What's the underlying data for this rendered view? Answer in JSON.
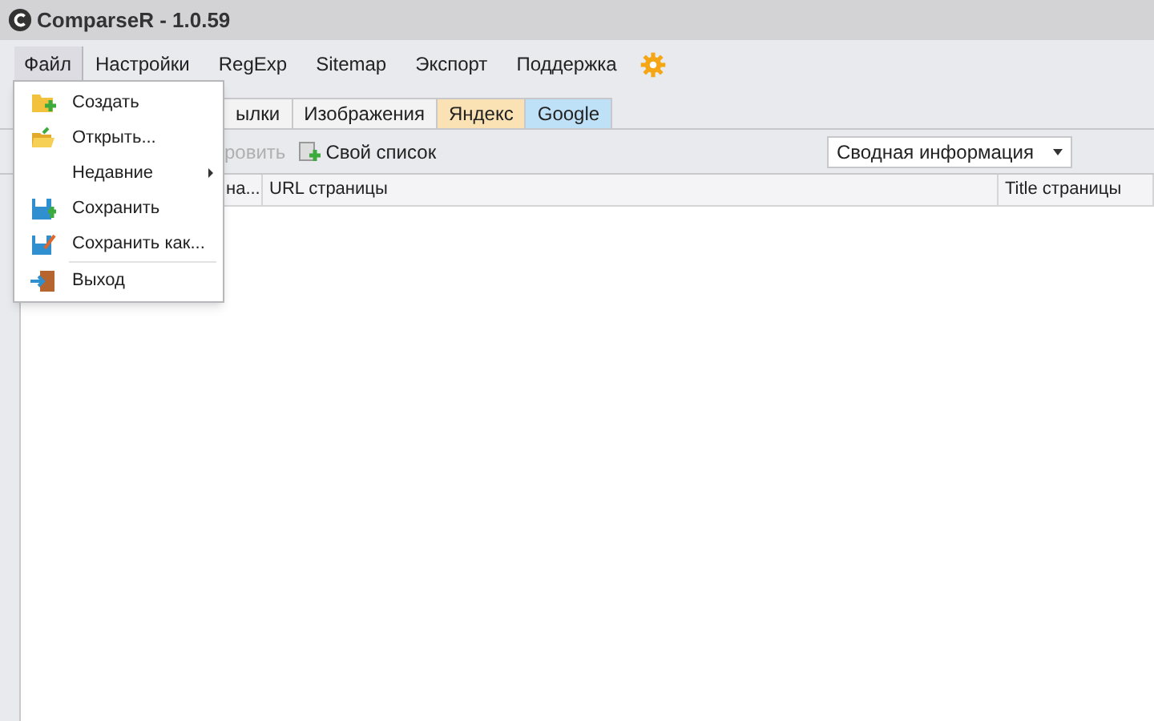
{
  "window": {
    "title": "ComparseR - 1.0.59"
  },
  "menu_bar": [
    {
      "label": "Файл",
      "selected": true
    },
    {
      "label": "Настройки",
      "selected": false
    },
    {
      "label": "RegExp",
      "selected": false
    },
    {
      "label": "Sitemap",
      "selected": false
    },
    {
      "label": "Экспорт",
      "selected": false
    },
    {
      "label": "Поддержка",
      "selected": false
    }
  ],
  "tabs": [
    {
      "label": "ылки",
      "color": "#f3f3f3"
    },
    {
      "label": "Изображения",
      "color": "#f3f3f3"
    },
    {
      "label": "Яндекс",
      "color": "#fbe2b4"
    },
    {
      "label": "Google",
      "color": "#bfe1f7"
    }
  ],
  "toolbar": [
    {
      "kind": "partial",
      "label": "ровить",
      "disabled": true
    },
    {
      "kind": "add",
      "label": "Свой список",
      "disabled": false
    }
  ],
  "view_select": {
    "value": "Сводная информация"
  },
  "table": {
    "columns": [
      "на...",
      "URL страницы",
      "Title страницы"
    ]
  },
  "file_menu": [
    {
      "kind": "new",
      "label": "Создать"
    },
    {
      "kind": "open",
      "label": "Открыть..."
    },
    {
      "kind": "submenu",
      "label": "Недавние"
    },
    {
      "kind": "save",
      "label": "Сохранить"
    },
    {
      "kind": "saveas",
      "label": "Сохранить как..."
    },
    {
      "kind": "exit",
      "label": "Выход",
      "separator": true
    }
  ]
}
